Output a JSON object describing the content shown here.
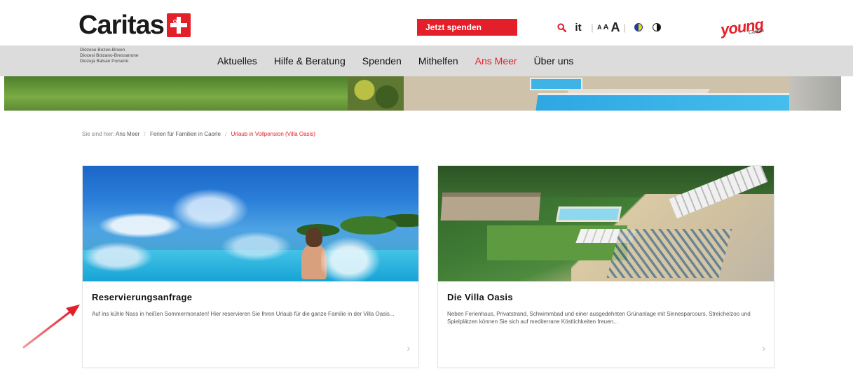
{
  "header": {
    "logo_text": "Caritas",
    "donate_label": "Jetzt spenden",
    "lang_label": "it",
    "fs_small": "A",
    "fs_mid": "A",
    "fs_big": "A",
    "sep": "|",
    "young_text": "young",
    "young_sub": "Caritas"
  },
  "diocese_lines": [
    "Diözese Bozen-Brixen",
    "Diocesi Bolzano-Bressanone",
    "Diozeja Balsan Porsenù"
  ],
  "nav": {
    "items": [
      {
        "label": "Aktuelles"
      },
      {
        "label": "Hilfe & Beratung"
      },
      {
        "label": "Spenden"
      },
      {
        "label": "Mithelfen"
      },
      {
        "label": "Ans Meer"
      },
      {
        "label": "Über uns"
      }
    ],
    "active_index": 4
  },
  "breadcrumb": {
    "prefix": "Sie sind hier:",
    "items": [
      {
        "label": "Ans Meer"
      },
      {
        "label": "Ferien für Familien in Caorle"
      },
      {
        "label": "Urlaub in Vollpension (Villa Oasis)"
      }
    ],
    "sep": "/"
  },
  "cards": [
    {
      "title": "Reservierungsanfrage",
      "text": "Auf ins kühle Nass in heißen Sommermonaten! Hier reservieren Sie Ihren Urlaub für die ganze Familie in der Villa Oasis...",
      "arrow": "›"
    },
    {
      "title": "Die Villa Oasis",
      "text": "Neben Ferienhaus, Privatstrand, Schwimmbad und einer ausgedehnten Grünanlage mit Sinnesparcours, Streichelzoo und Spielplätzen können Sie sich auf mediterrane Köstlichkeiten freuen...",
      "arrow": "›"
    }
  ],
  "colors": {
    "brand_red": "#e3202a",
    "nav_bg": "#dcdcdc",
    "annotation_arrow": "#e3202a"
  }
}
